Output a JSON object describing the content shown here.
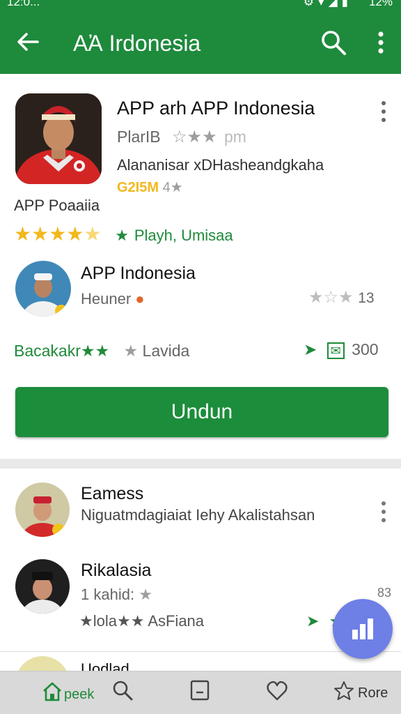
{
  "status_bar": {
    "time": "12:0...",
    "battery": "12%"
  },
  "app_bar": {
    "title": "AἈ Irdonesia"
  },
  "featured_app": {
    "title": "APP arh APP Indonesia",
    "meta": "PlarIB",
    "rating_text": "pm",
    "description": "Alananisar xDHasheandgkaha",
    "price_badge": "G2I5M",
    "price_suffix": "4★",
    "label": "APP Poaaiia",
    "stars": 4.5,
    "editor_label": "Playh, Umisaa"
  },
  "secondary_app": {
    "title": "APP Indonesia",
    "subtitle": "Heuner",
    "rating_count": "13",
    "category": "Bacakakr★★",
    "tag": "Lavida",
    "downloads": "300"
  },
  "install_button": {
    "label": "Undun"
  },
  "list": [
    {
      "title": "Eamess",
      "subtitle": "Niguatmdagiaiat Iehy Akalistahsan"
    },
    {
      "title": "Rikalasia",
      "subtitle": "1 kahid:",
      "extra": "★lola★★ AsFiana",
      "corner": "83",
      "right_label": "N6"
    },
    {
      "title": "Uodlad"
    }
  ],
  "bottom_nav": {
    "home_label": "peek",
    "more_label": "Rore"
  },
  "colors": {
    "primary": "#1e8a3c",
    "accent_gold": "#f2b81d",
    "fab": "#6e7fe6"
  }
}
